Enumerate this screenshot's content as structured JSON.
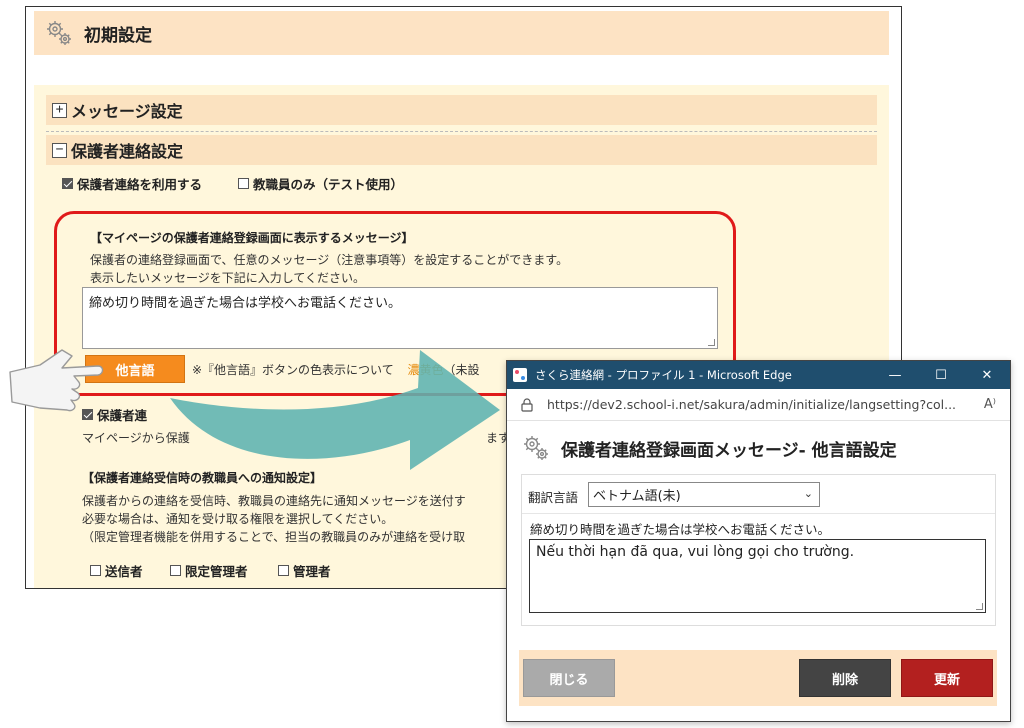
{
  "main": {
    "page_title": "初期設定",
    "sections": {
      "message_settings": {
        "toggle": "+",
        "title": "メッセージ設定"
      },
      "parent_contact": {
        "toggle": "−",
        "title": "保護者連絡設定"
      }
    },
    "checkboxes": {
      "use_parent_contact": {
        "label": "保護者連絡を利用する",
        "checked": true
      },
      "staff_only": {
        "label": "教職員のみ（テスト使用）",
        "checked": false
      }
    },
    "mypage_message": {
      "heading": "【マイページの保護者連絡登録画面に表示するメッセージ】",
      "desc1": "保護者の連絡登録画面で、任意のメッセージ（注意事項等）を設定することができます。",
      "desc2": "表示したいメッセージを下記に入力してください。",
      "textarea_value": "締め切り時間を過ぎた場合は学校へお電話ください。",
      "other_lang_button": "他言語",
      "note_prefix": "※『他言語』ボタンの色表示について",
      "note_color": "濃黄色",
      "note_suffix": "（未設"
    },
    "partial_check": {
      "label": "保護者連",
      "checked": true
    },
    "partial_line1": "マイページから保護",
    "partial_line1_tail": "ます。",
    "notify": {
      "heading": "【保護者連絡受信時の教職員への通知設定】",
      "line1": "保護者からの連絡を受信時、教職員の連絡先に通知メッセージを送付す",
      "line2": "必要な場合は、通知を受け取る権限を選択してください。",
      "line3": "（限定管理者機能を併用することで、担当の教職員のみが連絡を受け取",
      "options": [
        {
          "label": "送信者",
          "checked": false
        },
        {
          "label": "限定管理者",
          "checked": false
        },
        {
          "label": "管理者",
          "checked": false
        }
      ]
    }
  },
  "popup": {
    "window_title": "さくら連絡網 - プロファイル 1 - Microsoft Edge",
    "url": "https://dev2.school-i.net/sakura/admin/initialize/langsetting?col...",
    "read_aloud": "A⁾",
    "title": "保護者連絡登録画面メッセージ- 他言語設定",
    "lang_label": "翻訳言語",
    "lang_selected": "ベトナム語(未)",
    "source_message": "締め切り時間を過ぎた場合は学校へお電話ください。",
    "translation_value": "Nếu thời hạn đã qua, vui lòng gọi cho trường.",
    "buttons": {
      "close": "閉じる",
      "delete": "削除",
      "update": "更新"
    }
  },
  "icons": [
    "gear-icon",
    "pointing-hand-icon",
    "arrow-icon",
    "lock-icon",
    "read-aloud-icon"
  ],
  "colors": {
    "header_bg": "#fde3c4",
    "content_bg": "#fff7dc",
    "orange_button": "#f58b1e",
    "highlight": "#e01a1a",
    "arrow": "#5db3b0",
    "edge_titlebar": "#1f4e6e",
    "close_btn": "#aaaaaa",
    "delete_btn": "#444444",
    "update_btn": "#b3201f",
    "note_color_text": "#e58a0c"
  }
}
